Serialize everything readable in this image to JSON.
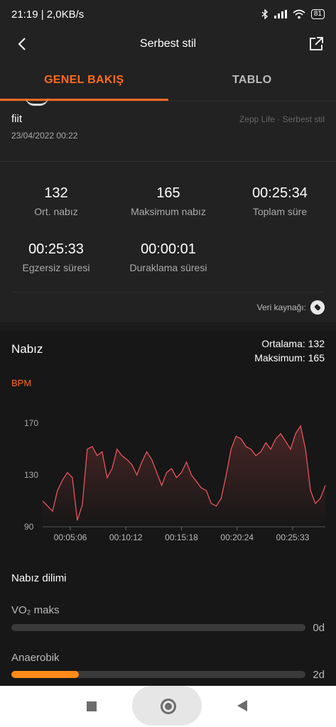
{
  "status": {
    "time_speed": "21:19 | 2,0KB/s",
    "battery": "81"
  },
  "header": {
    "title": "Serbest stil"
  },
  "tabs": [
    {
      "label": "GENEL BAKIŞ"
    },
    {
      "label": "TABLO"
    }
  ],
  "workout": {
    "name": "fiit",
    "date": "23/04/2022 00:22",
    "source": "Zepp Life · Serbest stil"
  },
  "stats": [
    {
      "value": "132",
      "label": "Ort. nabız"
    },
    {
      "value": "165",
      "label": "Maksimum nabız"
    },
    {
      "value": "00:25:34",
      "label": "Toplam süre"
    },
    {
      "value": "00:25:33",
      "label": "Egzersiz süresi"
    },
    {
      "value": "00:00:01",
      "label": "Duraklama süresi"
    }
  ],
  "data_source": {
    "label": "Veri kaynağı:"
  },
  "heart": {
    "title": "Nabız",
    "average": "Ortalama: 132",
    "maximum": "Maksimum: 165",
    "unit": "BPM"
  },
  "chart_data": {
    "type": "line",
    "ylabel": "BPM",
    "ylim": [
      90,
      180
    ],
    "yticks": [
      "170",
      "130",
      "90"
    ],
    "xticks": [
      "00:05:06",
      "00:10:12",
      "00:15:18",
      "00:20:24",
      "00:25:33"
    ],
    "x_minutes": [
      0,
      0.5,
      1,
      1.5,
      2,
      2.5,
      3,
      3.5,
      4,
      4.5,
      5,
      5.5,
      6,
      6.5,
      7,
      7.5,
      8,
      8.5,
      9,
      9.5,
      10,
      10.5,
      11,
      11.5,
      12,
      12.5,
      13,
      13.5,
      14,
      14.5,
      15,
      15.5,
      16,
      16.5,
      17,
      17.5,
      18,
      18.5,
      19,
      19.5,
      20,
      20.5,
      21,
      21.5,
      22,
      22.5,
      23,
      23.5,
      24,
      24.5,
      25,
      25.5,
      26,
      26.5,
      27,
      27.5,
      28,
      28.5
    ],
    "bpm": [
      110,
      106,
      102,
      118,
      126,
      132,
      128,
      95,
      107,
      150,
      152,
      145,
      148,
      128,
      135,
      150,
      145,
      142,
      138,
      130,
      140,
      148,
      142,
      132,
      122,
      132,
      135,
      128,
      132,
      140,
      130,
      125,
      120,
      118,
      108,
      106,
      112,
      130,
      150,
      160,
      158,
      152,
      150,
      145,
      148,
      155,
      150,
      158,
      162,
      156,
      150,
      162,
      168,
      150,
      118,
      108,
      112,
      122
    ]
  },
  "zones": {
    "title": "Nabız dilimi",
    "items": [
      {
        "label": "VO₂ maks",
        "value": "0d",
        "fraction": 0
      },
      {
        "label": "Anaerobik",
        "value": "2d",
        "fraction": 0.23
      }
    ]
  }
}
